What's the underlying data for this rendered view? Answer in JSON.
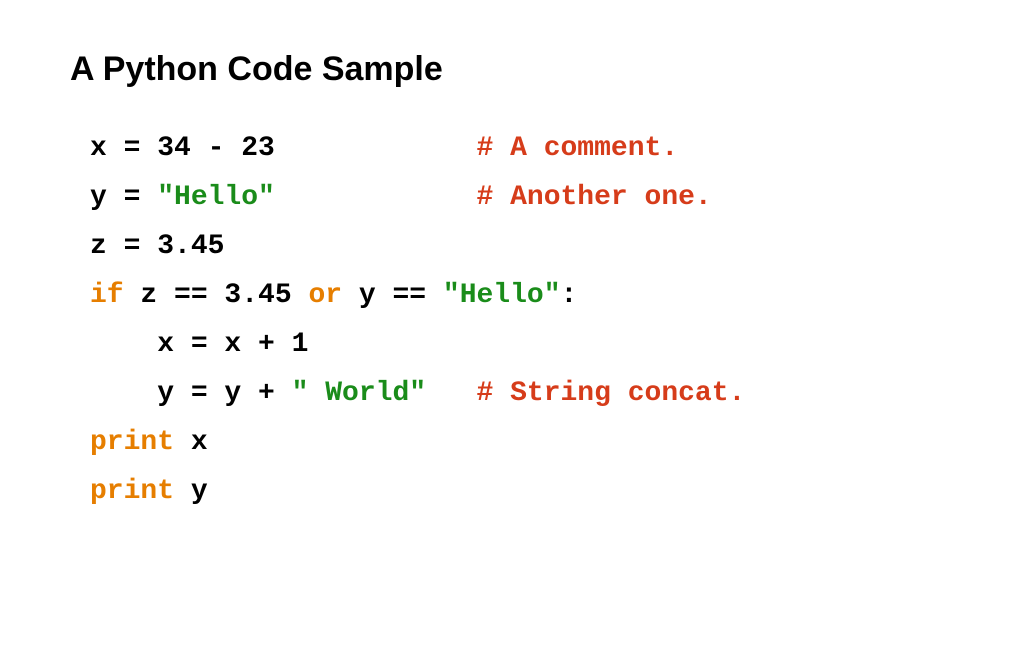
{
  "title": "A Python Code Sample",
  "code": {
    "line1": {
      "text": "x = 34 - 23",
      "comment": "# A comment."
    },
    "line2": {
      "lhs": "y = ",
      "str": "\"Hello\"",
      "comment": "# Another one."
    },
    "line3": {
      "text": "z = 3.45"
    },
    "line4": {
      "kw1": "if",
      "seg1": " z == 3.45 ",
      "kw2": "or",
      "seg2": " y == ",
      "str": "\"Hello\"",
      "tail": ":"
    },
    "line5": {
      "text": "    x = x + 1"
    },
    "line6": {
      "lhs": "    y = y + ",
      "str": "\" World\"",
      "comment": "# String concat."
    },
    "line7": {
      "kw": "print",
      "arg": " x"
    },
    "line8": {
      "kw": "print",
      "arg": " y"
    }
  }
}
